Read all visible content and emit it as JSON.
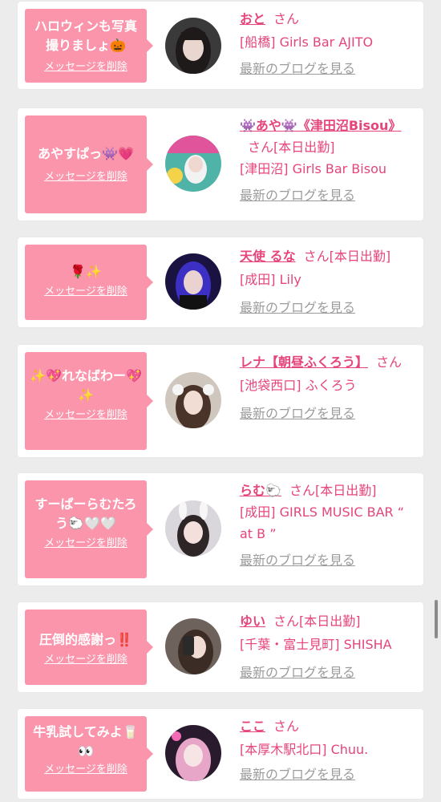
{
  "delete_label": "メッセージを削除",
  "blog_label": "最新のブログを見る",
  "san_label": "さん",
  "accent_color": "#fb95ac",
  "name_color": "#e5457a",
  "cards": [
    {
      "message": "ハロウィンも写真撮りましょ🎃",
      "name": "おと",
      "status": "",
      "shop": "[船橋] Girls Bar AJITO",
      "avatar": "dark-haired"
    },
    {
      "message": "あやすぱっ👾💗",
      "name": "👾あや👾《津田沼Bisou》",
      "status": "[本日出勤]",
      "shop": "[津田沼] Girls Bar Bisou",
      "avatar": "amusement"
    },
    {
      "message": "🌹✨",
      "name": "天使 るな",
      "status": "[本日出勤]",
      "shop": "[成田] Lily",
      "avatar": "blue-hair"
    },
    {
      "message": "✨💖れなばわー💖✨",
      "name": "レナ【朝昼ふくろう】",
      "status": "",
      "shop": "[池袋西口] ふくろう",
      "avatar": "sheep-ears"
    },
    {
      "message": "すーぱーらむたろう🐑🤍🤍",
      "name": "らむ🐑",
      "status": "[本日出勤]",
      "shop": "[成田] GIRLS MUSIC BAR “ at B ”",
      "avatar": "bunny-ears"
    },
    {
      "message": "圧倒的感謝っ‼️",
      "name": "ゆい",
      "status": "[本日出勤]",
      "shop": "[千葉・富士見町] SHISHA",
      "avatar": "selfie"
    },
    {
      "message": "牛乳試してみよ🥛👀",
      "name": "ここ",
      "status": "",
      "shop": "[本厚木駅北口] Chuu.",
      "avatar": "pink-light"
    }
  ]
}
